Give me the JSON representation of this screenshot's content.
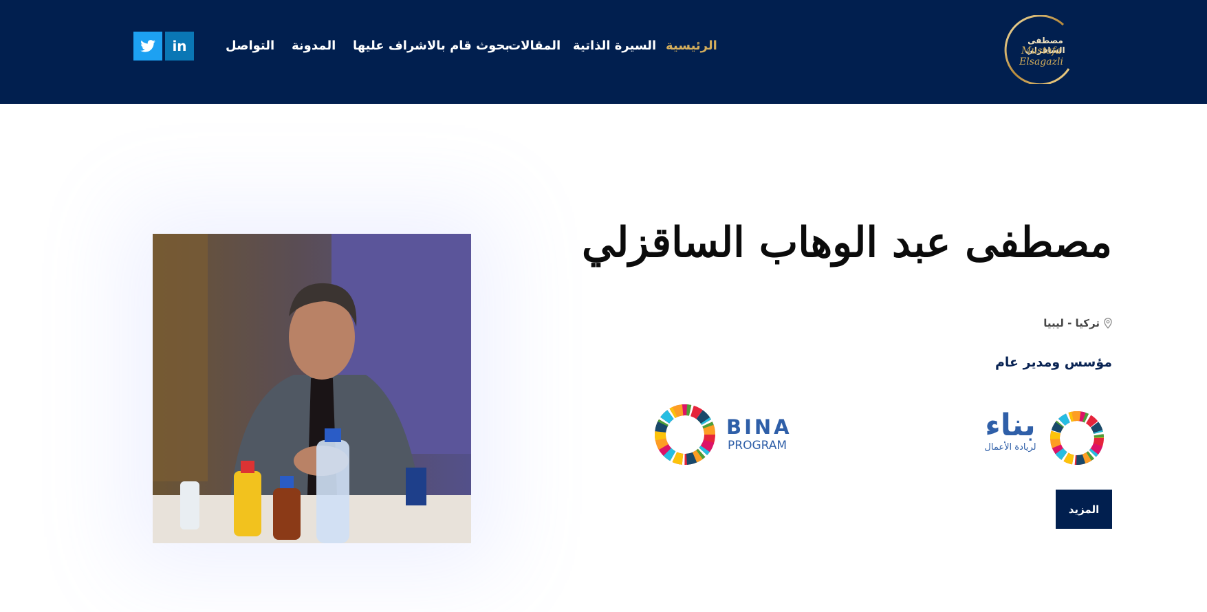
{
  "header": {
    "logo": {
      "arabic_name": "مصطفى الساقزلي",
      "signature": "Mustafa Elsagazli"
    },
    "nav_items": [
      {
        "label": "الرئيسية",
        "active": true
      },
      {
        "label": "السيرة الذاتية",
        "active": false
      },
      {
        "label": "المقالات",
        "active": false
      },
      {
        "label": "بحوث قام بالاشراف عليها",
        "active": false
      },
      {
        "label": "المدونة",
        "active": false
      },
      {
        "label": "التواصل",
        "active": false
      }
    ],
    "social": {
      "linkedin_label": "in",
      "twitter_icon": "twitter-icon"
    },
    "colors": {
      "navbar_bg": "#011f4f",
      "active_link": "#d3ad5c",
      "linkedin": "#0a77b5",
      "twitter": "#1da1f2"
    }
  },
  "hero": {
    "name": "مصطفى عبد الوهاب الساقزلي",
    "location": "تركيا - ليبيا",
    "location_icon": "map-pin-icon",
    "role": "مؤسس ومدير عام",
    "logos": {
      "arabic": {
        "text": "بناء",
        "subtitle": "لريادة الأعمال"
      },
      "english": {
        "text": "BINA",
        "subtitle": "PROGRAM"
      }
    },
    "more_button": "المزيد",
    "photo_alt": "portrait photo"
  }
}
